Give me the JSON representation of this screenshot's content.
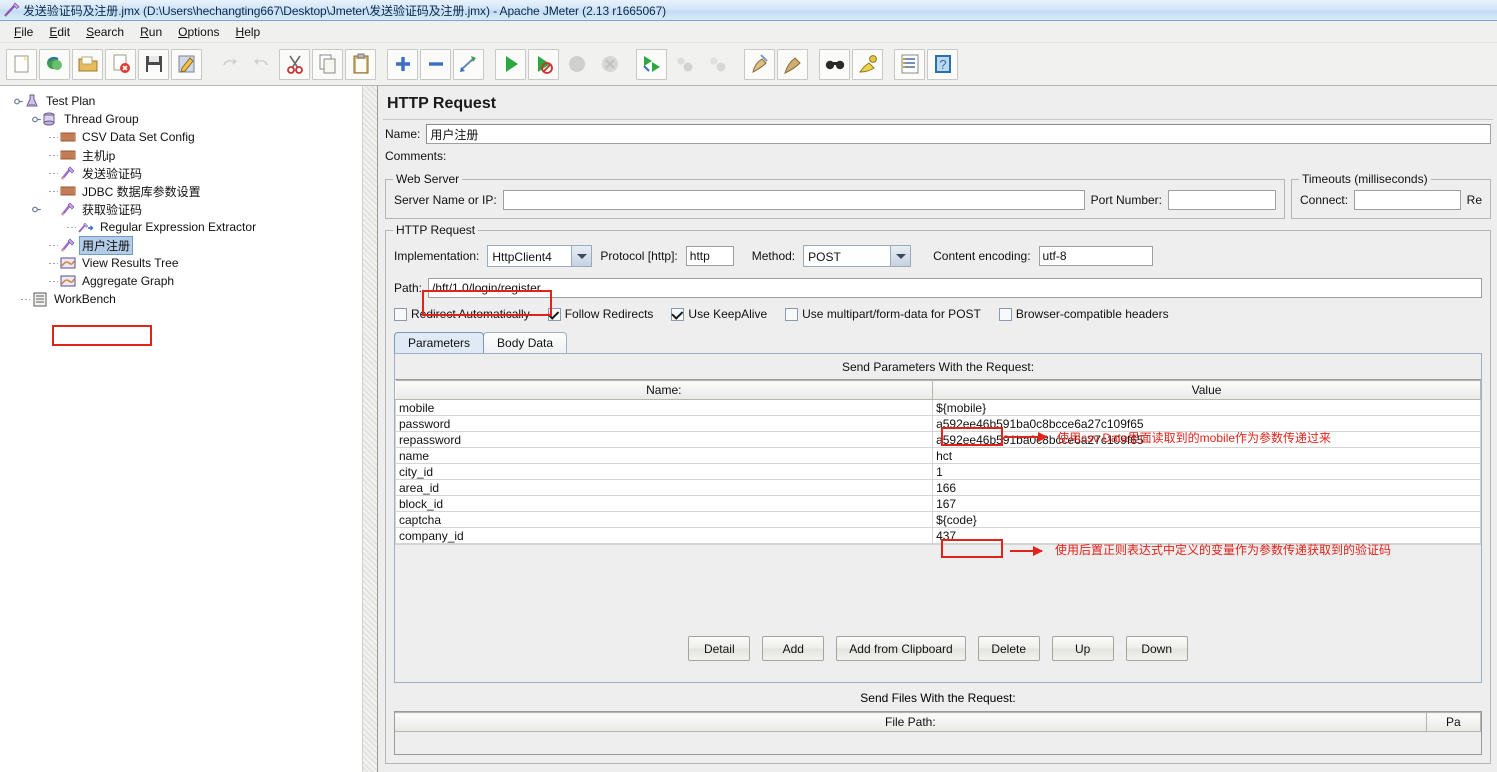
{
  "window": {
    "title": "发送验证码及注册.jmx (D:\\Users\\hechangting667\\Desktop\\Jmeter\\发送验证码及注册.jmx) - Apache JMeter (2.13 r1665067)",
    "app_icon": "jmeter-feather-icon"
  },
  "menu": {
    "items": [
      {
        "label": "File",
        "mnemonic": "F"
      },
      {
        "label": "Edit",
        "mnemonic": "E"
      },
      {
        "label": "Search",
        "mnemonic": "S"
      },
      {
        "label": "Run",
        "mnemonic": "R"
      },
      {
        "label": "Options",
        "mnemonic": "O"
      },
      {
        "label": "Help",
        "mnemonic": "H"
      }
    ]
  },
  "toolbar": {
    "buttons": [
      {
        "name": "new-icon",
        "tip": "New",
        "enabled": true
      },
      {
        "name": "templates-icon",
        "tip": "Templates",
        "enabled": true
      },
      {
        "name": "open-icon",
        "tip": "Open",
        "enabled": true
      },
      {
        "name": "close-icon",
        "tip": "Close",
        "enabled": true
      },
      {
        "name": "save-icon",
        "tip": "Save",
        "enabled": true
      },
      {
        "name": "save-as-icon",
        "tip": "Save Test Plan as",
        "enabled": true
      },
      {
        "name": "undo-icon",
        "tip": "Undo",
        "enabled": false
      },
      {
        "name": "redo-icon",
        "tip": "Redo",
        "enabled": false
      },
      {
        "name": "cut-icon",
        "tip": "Cut",
        "enabled": true
      },
      {
        "name": "copy-icon",
        "tip": "Copy",
        "enabled": true
      },
      {
        "name": "paste-icon",
        "tip": "Paste",
        "enabled": true
      },
      {
        "name": "expand-all-icon",
        "tip": "Expand All",
        "enabled": true
      },
      {
        "name": "collapse-all-icon",
        "tip": "Collapse All",
        "enabled": true
      },
      {
        "name": "toggle-icon",
        "tip": "Toggle",
        "enabled": true
      },
      {
        "name": "start-icon",
        "tip": "Start",
        "enabled": true
      },
      {
        "name": "start-no-pauses-icon",
        "tip": "Start no pauses",
        "enabled": true
      },
      {
        "name": "stop-icon",
        "tip": "Stop",
        "enabled": false
      },
      {
        "name": "shutdown-icon",
        "tip": "Shutdown",
        "enabled": false
      },
      {
        "name": "remote-start-all-icon",
        "tip": "Remote Start All",
        "enabled": true
      },
      {
        "name": "remote-stop-all-icon",
        "tip": "Remote Stop All",
        "enabled": false
      },
      {
        "name": "remote-shutdown-all-icon",
        "tip": "Remote Shutdown All",
        "enabled": false
      },
      {
        "name": "clear-icon",
        "tip": "Clear",
        "enabled": true
      },
      {
        "name": "clear-all-icon",
        "tip": "Clear All",
        "enabled": true
      },
      {
        "name": "search-icon",
        "tip": "Search",
        "enabled": true
      },
      {
        "name": "search-reset-icon",
        "tip": "Reset Search",
        "enabled": true
      },
      {
        "name": "function-helper-icon",
        "tip": "Function Helper Dialog",
        "enabled": true
      },
      {
        "name": "help-icon",
        "tip": "Help",
        "enabled": true
      }
    ]
  },
  "tree": {
    "nodes": [
      {
        "label": "Test Plan",
        "icon": "test-plan-icon",
        "depth": 0,
        "expander": "expanded",
        "selected": false
      },
      {
        "label": "Thread Group",
        "icon": "thread-group-icon",
        "depth": 1,
        "expander": "expanded",
        "selected": false
      },
      {
        "label": "CSV Data Set Config",
        "icon": "config-element-icon",
        "depth": 2,
        "expander": "none",
        "selected": false
      },
      {
        "label": "主机ip",
        "icon": "config-element-icon",
        "depth": 2,
        "expander": "none",
        "selected": false
      },
      {
        "label": "发送验证码",
        "icon": "http-sampler-icon",
        "depth": 2,
        "expander": "none",
        "selected": false
      },
      {
        "label": "JDBC 数据库参数设置",
        "icon": "config-element-icon",
        "depth": 2,
        "expander": "none",
        "selected": false
      },
      {
        "label": "获取验证码",
        "icon": "http-sampler-icon",
        "depth": 2,
        "expander": "expanded",
        "selected": false
      },
      {
        "label": "Regular Expression Extractor",
        "icon": "post-processor-icon",
        "depth": 3,
        "expander": "none",
        "selected": false
      },
      {
        "label": "用户注册",
        "icon": "http-sampler-icon",
        "depth": 2,
        "expander": "none",
        "selected": true
      },
      {
        "label": "View Results Tree",
        "icon": "listener-icon",
        "depth": 2,
        "expander": "none",
        "selected": false
      },
      {
        "label": "Aggregate Graph",
        "icon": "listener-icon",
        "depth": 2,
        "expander": "none",
        "selected": false
      },
      {
        "label": "WorkBench",
        "icon": "workbench-icon",
        "depth": 0,
        "expander": "none",
        "selected": false
      }
    ]
  },
  "panel": {
    "title": "HTTP Request",
    "name_label": "Name:",
    "name_value": "用户注册",
    "comments_label": "Comments:",
    "comments_value": "",
    "web_server": {
      "legend": "Web Server",
      "server_label": "Server Name or IP:",
      "server_value": "",
      "port_label": "Port Number:",
      "port_value": ""
    },
    "timeouts": {
      "legend": "Timeouts (milliseconds)",
      "connect_label": "Connect:",
      "connect_value": "",
      "response_label": "Re"
    },
    "http_request": {
      "legend": "HTTP Request",
      "implementation_label": "Implementation:",
      "implementation_value": "HttpClient4",
      "protocol_label": "Protocol [http]:",
      "protocol_value": "http",
      "method_label": "Method:",
      "method_value": "POST",
      "content_encoding_label": "Content encoding:",
      "content_encoding_value": "utf-8",
      "path_label": "Path:",
      "path_value": "/hft/1.0/login/register",
      "checkboxes": [
        {
          "label": "Redirect Automatically",
          "checked": false
        },
        {
          "label": "Follow Redirects",
          "checked": true
        },
        {
          "label": "Use KeepAlive",
          "checked": true
        },
        {
          "label": "Use multipart/form-data for POST",
          "checked": false
        },
        {
          "label": "Browser-compatible headers",
          "checked": false
        }
      ]
    },
    "tabs": [
      {
        "label": "Parameters",
        "active": true
      },
      {
        "label": "Body Data",
        "active": false
      }
    ],
    "params_caption": "Send Parameters With the Request:",
    "params_columns": [
      "Name:",
      "Value"
    ],
    "params_rows": [
      {
        "name": "mobile",
        "value": "${mobile}",
        "highlight": true
      },
      {
        "name": "password",
        "value": "a592ee46b591ba0c8bcce6a27c109f65",
        "highlight": false
      },
      {
        "name": "repassword",
        "value": "a592ee46b591ba0c8bcce6a27c109f65",
        "highlight": false
      },
      {
        "name": "name",
        "value": "hct",
        "highlight": false
      },
      {
        "name": "city_id",
        "value": "1",
        "highlight": false
      },
      {
        "name": "area_id",
        "value": "166",
        "highlight": false
      },
      {
        "name": "block_id",
        "value": "167",
        "highlight": false
      },
      {
        "name": "captcha",
        "value": "${code}",
        "highlight": true
      },
      {
        "name": "company_id",
        "value": "437",
        "highlight": false
      }
    ],
    "action_buttons": [
      "Detail",
      "Add",
      "Add from Clipboard",
      "Delete",
      "Up",
      "Down"
    ],
    "files_caption": "Send Files With the Request:",
    "files_columns": [
      "File Path:",
      "Pa"
    ]
  },
  "annotations": {
    "color": "#e2231a",
    "items": [
      {
        "text": "使用csv Data里面读取到的mobile作为参数传递过来",
        "target": "mobile-value"
      },
      {
        "text": "使用后置正则表达式中定义的变量作为参数传递获取到的验证码",
        "target": "captcha-value"
      }
    ]
  }
}
